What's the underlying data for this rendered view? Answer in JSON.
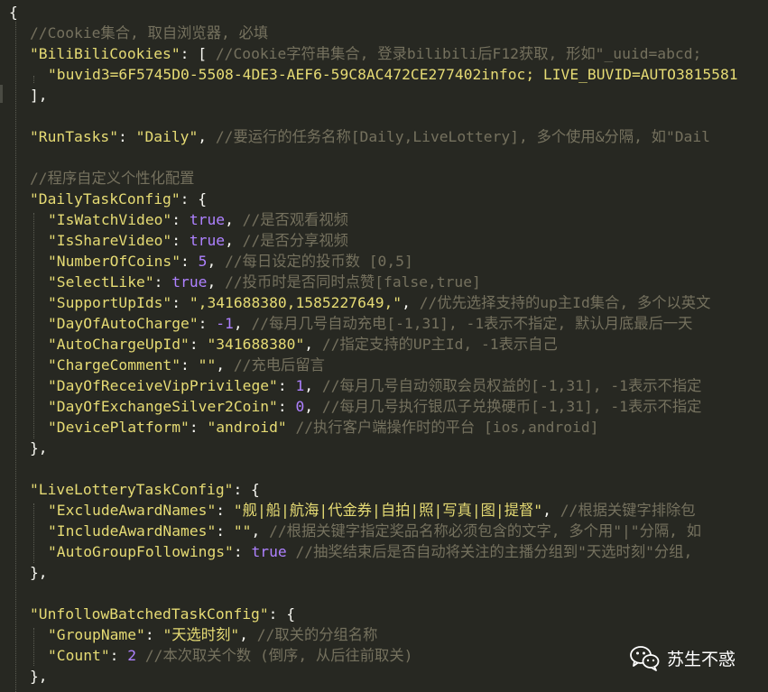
{
  "editor": {
    "lines": [
      {
        "indent": 0,
        "tokens": [
          {
            "t": "p",
            "v": "{"
          }
        ]
      },
      {
        "indent": 1,
        "tokens": [
          {
            "t": "c",
            "v": "//Cookie集合, 取自浏览器, 必填"
          }
        ]
      },
      {
        "indent": 1,
        "tokens": [
          {
            "t": "k",
            "v": "\"BiliBiliCookies\""
          },
          {
            "t": "p",
            "v": ": [ "
          },
          {
            "t": "c",
            "v": "//Cookie字符串集合, 登录bilibili后F12获取, 形如\"_uuid=abcd; "
          }
        ]
      },
      {
        "indent": 2,
        "tokens": [
          {
            "t": "s",
            "v": "\"buvid3=6F5745D0-5508-4DE3-AEF6-59C8AC472CE277402infoc; LIVE_BUVID=AUTO3815581"
          }
        ]
      },
      {
        "indent": 1,
        "tokens": [
          {
            "t": "p",
            "v": "],"
          }
        ]
      },
      {
        "indent": 1,
        "tokens": []
      },
      {
        "indent": 1,
        "tokens": [
          {
            "t": "k",
            "v": "\"RunTasks\""
          },
          {
            "t": "p",
            "v": ": "
          },
          {
            "t": "s",
            "v": "\"Daily\""
          },
          {
            "t": "p",
            "v": ", "
          },
          {
            "t": "c",
            "v": "//要运行的任务名称[Daily,LiveLottery], 多个使用&分隔, 如\"Dail"
          }
        ]
      },
      {
        "indent": 1,
        "tokens": []
      },
      {
        "indent": 1,
        "tokens": [
          {
            "t": "c",
            "v": "//程序自定义个性化配置"
          }
        ]
      },
      {
        "indent": 1,
        "tokens": [
          {
            "t": "k",
            "v": "\"DailyTaskConfig\""
          },
          {
            "t": "p",
            "v": ": {"
          }
        ]
      },
      {
        "indent": 2,
        "tokens": [
          {
            "t": "k",
            "v": "\"IsWatchVideo\""
          },
          {
            "t": "p",
            "v": ": "
          },
          {
            "t": "b",
            "v": "true"
          },
          {
            "t": "p",
            "v": ", "
          },
          {
            "t": "c",
            "v": "//是否观看视频"
          }
        ]
      },
      {
        "indent": 2,
        "tokens": [
          {
            "t": "k",
            "v": "\"IsShareVideo\""
          },
          {
            "t": "p",
            "v": ": "
          },
          {
            "t": "b",
            "v": "true"
          },
          {
            "t": "p",
            "v": ", "
          },
          {
            "t": "c",
            "v": "//是否分享视频"
          }
        ]
      },
      {
        "indent": 2,
        "tokens": [
          {
            "t": "k",
            "v": "\"NumberOfCoins\""
          },
          {
            "t": "p",
            "v": ": "
          },
          {
            "t": "n",
            "v": "5"
          },
          {
            "t": "p",
            "v": ", "
          },
          {
            "t": "c",
            "v": "//每日设定的投币数 [0,5]"
          }
        ]
      },
      {
        "indent": 2,
        "tokens": [
          {
            "t": "k",
            "v": "\"SelectLike\""
          },
          {
            "t": "p",
            "v": ": "
          },
          {
            "t": "b",
            "v": "true"
          },
          {
            "t": "p",
            "v": ", "
          },
          {
            "t": "c",
            "v": "//投币时是否同时点赞[false,true]"
          }
        ]
      },
      {
        "indent": 2,
        "tokens": [
          {
            "t": "k",
            "v": "\"SupportUpIds\""
          },
          {
            "t": "p",
            "v": ": "
          },
          {
            "t": "s",
            "v": "\",341688380,1585227649,\""
          },
          {
            "t": "p",
            "v": ", "
          },
          {
            "t": "c",
            "v": "//优先选择支持的up主Id集合, 多个以英文"
          }
        ]
      },
      {
        "indent": 2,
        "tokens": [
          {
            "t": "k",
            "v": "\"DayOfAutoCharge\""
          },
          {
            "t": "p",
            "v": ": "
          },
          {
            "t": "n",
            "v": "-1"
          },
          {
            "t": "p",
            "v": ", "
          },
          {
            "t": "c",
            "v": "//每月几号自动充电[-1,31], -1表示不指定, 默认月底最后一天"
          }
        ]
      },
      {
        "indent": 2,
        "tokens": [
          {
            "t": "k",
            "v": "\"AutoChargeUpId\""
          },
          {
            "t": "p",
            "v": ": "
          },
          {
            "t": "s",
            "v": "\"341688380\""
          },
          {
            "t": "p",
            "v": ", "
          },
          {
            "t": "c",
            "v": "//指定支持的UP主Id, -1表示自己"
          }
        ]
      },
      {
        "indent": 2,
        "tokens": [
          {
            "t": "k",
            "v": "\"ChargeComment\""
          },
          {
            "t": "p",
            "v": ": "
          },
          {
            "t": "s",
            "v": "\"\""
          },
          {
            "t": "p",
            "v": ", "
          },
          {
            "t": "c",
            "v": "//充电后留言"
          }
        ]
      },
      {
        "indent": 2,
        "tokens": [
          {
            "t": "k",
            "v": "\"DayOfReceiveVipPrivilege\""
          },
          {
            "t": "p",
            "v": ": "
          },
          {
            "t": "n",
            "v": "1"
          },
          {
            "t": "p",
            "v": ", "
          },
          {
            "t": "c",
            "v": "//每月几号自动领取会员权益的[-1,31], -1表示不指定"
          }
        ]
      },
      {
        "indent": 2,
        "tokens": [
          {
            "t": "k",
            "v": "\"DayOfExchangeSilver2Coin\""
          },
          {
            "t": "p",
            "v": ": "
          },
          {
            "t": "n",
            "v": "0"
          },
          {
            "t": "p",
            "v": ", "
          },
          {
            "t": "c",
            "v": "//每月几号执行银瓜子兑换硬币[-1,31], -1表示不指定"
          }
        ]
      },
      {
        "indent": 2,
        "tokens": [
          {
            "t": "k",
            "v": "\"DevicePlatform\""
          },
          {
            "t": "p",
            "v": ": "
          },
          {
            "t": "s",
            "v": "\"android\""
          },
          {
            "t": "p",
            "v": " "
          },
          {
            "t": "c",
            "v": "//执行客户端操作时的平台 [ios,android]"
          }
        ]
      },
      {
        "indent": 1,
        "tokens": [
          {
            "t": "p",
            "v": "},"
          }
        ]
      },
      {
        "indent": 1,
        "tokens": []
      },
      {
        "indent": 1,
        "tokens": [
          {
            "t": "k",
            "v": "\"LiveLotteryTaskConfig\""
          },
          {
            "t": "p",
            "v": ": {"
          }
        ]
      },
      {
        "indent": 2,
        "tokens": [
          {
            "t": "k",
            "v": "\"ExcludeAwardNames\""
          },
          {
            "t": "p",
            "v": ": "
          },
          {
            "t": "s",
            "v": "\"舰|船|航海|代金券|自拍|照|写真|图|提督\""
          },
          {
            "t": "p",
            "v": ", "
          },
          {
            "t": "c",
            "v": "//根据关键字排除包"
          }
        ]
      },
      {
        "indent": 2,
        "tokens": [
          {
            "t": "k",
            "v": "\"IncludeAwardNames\""
          },
          {
            "t": "p",
            "v": ": "
          },
          {
            "t": "s",
            "v": "\"\""
          },
          {
            "t": "p",
            "v": ", "
          },
          {
            "t": "c",
            "v": "//根据关键字指定奖品名称必须包含的文字, 多个用\"|\"分隔, 如"
          }
        ]
      },
      {
        "indent": 2,
        "tokens": [
          {
            "t": "k",
            "v": "\"AutoGroupFollowings\""
          },
          {
            "t": "p",
            "v": ": "
          },
          {
            "t": "b",
            "v": "true"
          },
          {
            "t": "p",
            "v": " "
          },
          {
            "t": "c",
            "v": "//抽奖结束后是否自动将关注的主播分组到\"天选时刻\"分组,"
          }
        ]
      },
      {
        "indent": 1,
        "tokens": [
          {
            "t": "p",
            "v": "},"
          }
        ]
      },
      {
        "indent": 1,
        "tokens": []
      },
      {
        "indent": 1,
        "tokens": [
          {
            "t": "k",
            "v": "\"UnfollowBatchedTaskConfig\""
          },
          {
            "t": "p",
            "v": ": {"
          }
        ]
      },
      {
        "indent": 2,
        "tokens": [
          {
            "t": "k",
            "v": "\"GroupName\""
          },
          {
            "t": "p",
            "v": ": "
          },
          {
            "t": "s",
            "v": "\"天选时刻\""
          },
          {
            "t": "p",
            "v": ", "
          },
          {
            "t": "c",
            "v": "//取关的分组名称"
          }
        ]
      },
      {
        "indent": 2,
        "tokens": [
          {
            "t": "k",
            "v": "\"Count\""
          },
          {
            "t": "p",
            "v": ": "
          },
          {
            "t": "n",
            "v": "2"
          },
          {
            "t": "p",
            "v": " "
          },
          {
            "t": "c",
            "v": "//本次取关个数 (倒序, 从后往前取关)"
          }
        ]
      },
      {
        "indent": 1,
        "tokens": [
          {
            "t": "p",
            "v": "},"
          }
        ]
      }
    ]
  },
  "watermark": {
    "icon": "wechat-icon",
    "label": "苏生不惑"
  },
  "colors": {
    "background": "#272822",
    "text": "#f8f8f2",
    "string": "#e6db74",
    "constant": "#ae81ff",
    "comment": "#75715e"
  }
}
